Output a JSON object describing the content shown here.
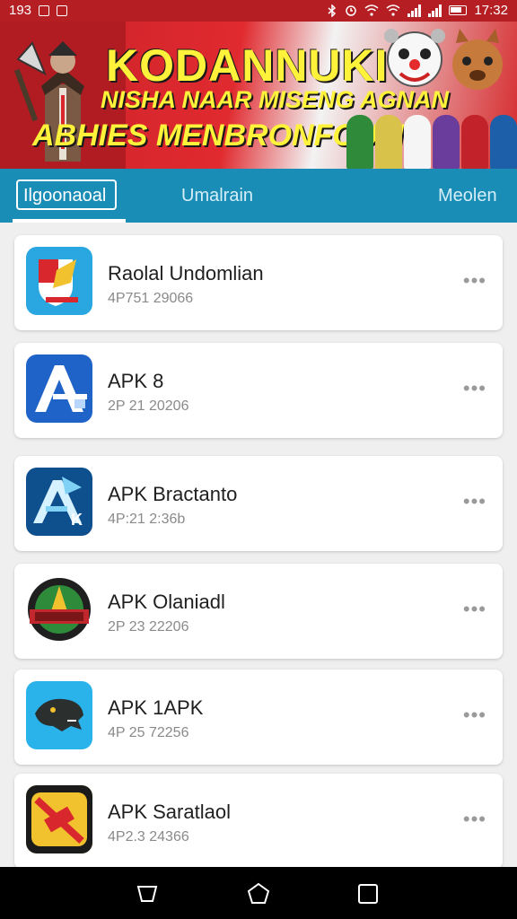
{
  "status_bar": {
    "time_left": "193",
    "time_right": "17:32"
  },
  "banner": {
    "line1": "KODANNUKI",
    "line2": "NISHA NAAR MISENG AGNAN",
    "line3": "ABHIES MENBRONFOUM"
  },
  "tabs": [
    {
      "label": "Ilgoonaoal"
    },
    {
      "label": "Umalrain"
    },
    {
      "label": "Meolen"
    }
  ],
  "apps": [
    {
      "name": "Raolal Undomlian",
      "meta": "4P751 29066",
      "icon": "shield-app-icon"
    },
    {
      "name": "APK 8",
      "meta": "2P 21 20206",
      "icon": "letter-a-app-icon"
    },
    {
      "name": "APK Bractanto",
      "meta": "4P:21 2:36b",
      "icon": "letter-a-k-app-icon"
    },
    {
      "name": "APK Olaniadl",
      "meta": "2P 23 22206",
      "icon": "warrior-badge-app-icon"
    },
    {
      "name": "APK 1APK",
      "meta": "4P 25 72256",
      "icon": "panther-app-icon"
    },
    {
      "name": "APK Saratlaol",
      "meta": "4P2.3 24366",
      "icon": "blocked-app-icon"
    }
  ],
  "more_glyph": "•••",
  "colors": {
    "status_bar": "#b51f24",
    "tab_bar": "#1a8db7",
    "background": "#efefef"
  }
}
